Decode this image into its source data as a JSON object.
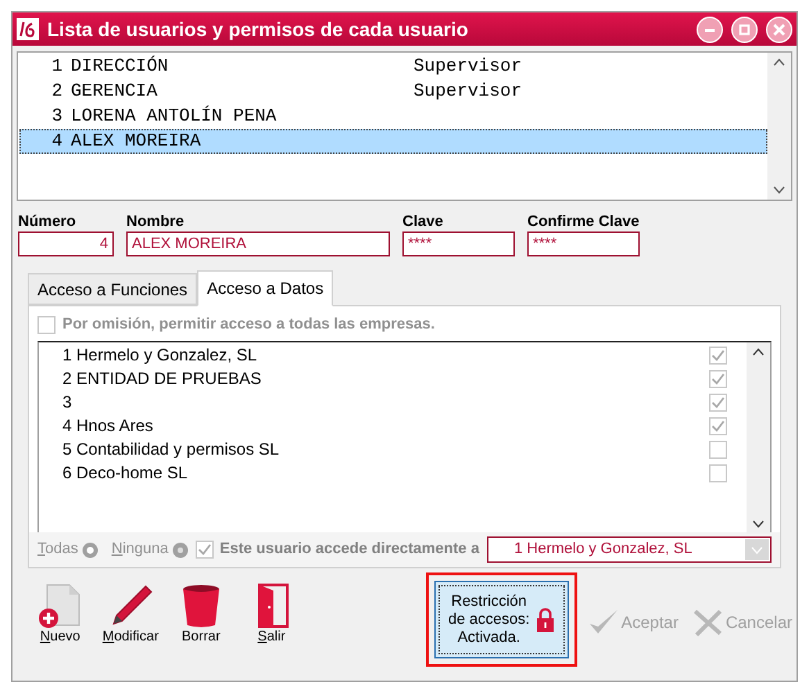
{
  "window": {
    "title": "Lista de usuarios y permisos de cada usuario"
  },
  "users": [
    {
      "number": "1",
      "name": "DIRECCIÓN",
      "role": "Supervisor",
      "selected": false
    },
    {
      "number": "2",
      "name": "GERENCIA",
      "role": "Supervisor",
      "selected": false
    },
    {
      "number": "3",
      "name": "LORENA ANTOLÍN PENA",
      "selected": false
    },
    {
      "number": "4",
      "name": "ALEX MOREIRA",
      "selected": true
    }
  ],
  "fields": [
    {
      "label": "Número",
      "value": "4"
    },
    {
      "label": "Nombre",
      "value": "ALEX MOREIRA"
    },
    {
      "label": "Clave",
      "value": "****"
    },
    {
      "label": "Confirme Clave",
      "value": "****"
    }
  ],
  "tabs": [
    {
      "label": "Acceso a Funciones",
      "selected": false
    },
    {
      "label": "Acceso a Datos",
      "selected": true
    }
  ],
  "default_access": {
    "label": "Por omisión, permitir acceso a todas las empresas.",
    "checked": false
  },
  "companies": [
    {
      "label": "1 Hermelo y Gonzalez, SL",
      "checked": true
    },
    {
      "label": "2 ENTIDAD DE PRUEBAS",
      "checked": true
    },
    {
      "label": "3",
      "checked": true
    },
    {
      "label": "4 Hnos Ares",
      "checked": true
    },
    {
      "label": "5 Contabilidad y permisos SL",
      "checked": false
    },
    {
      "label": "6 Deco-home SL",
      "checked": false
    }
  ],
  "select_all": "Todas",
  "select_none": "Ninguna",
  "direct_access": {
    "label": "Este usuario accede directamente a",
    "checked": true,
    "value": "1 Hermelo y Gonzalez, SL"
  },
  "toolbar": [
    {
      "kind": "new",
      "label": "Nuevo",
      "underline_first": true
    },
    {
      "kind": "edit",
      "label": "Modificar",
      "underline_first": true
    },
    {
      "kind": "delete",
      "label": "Borrar",
      "underline_first": false
    },
    {
      "kind": "exit",
      "label": "Salir",
      "underline_first": true
    }
  ],
  "restriction": {
    "lines": [
      "Restricción",
      "de accesos:",
      "Activada."
    ]
  },
  "actions": [
    {
      "kind": "accept",
      "label": "Aceptar"
    },
    {
      "kind": "cancel",
      "label": "Cancelar"
    }
  ]
}
